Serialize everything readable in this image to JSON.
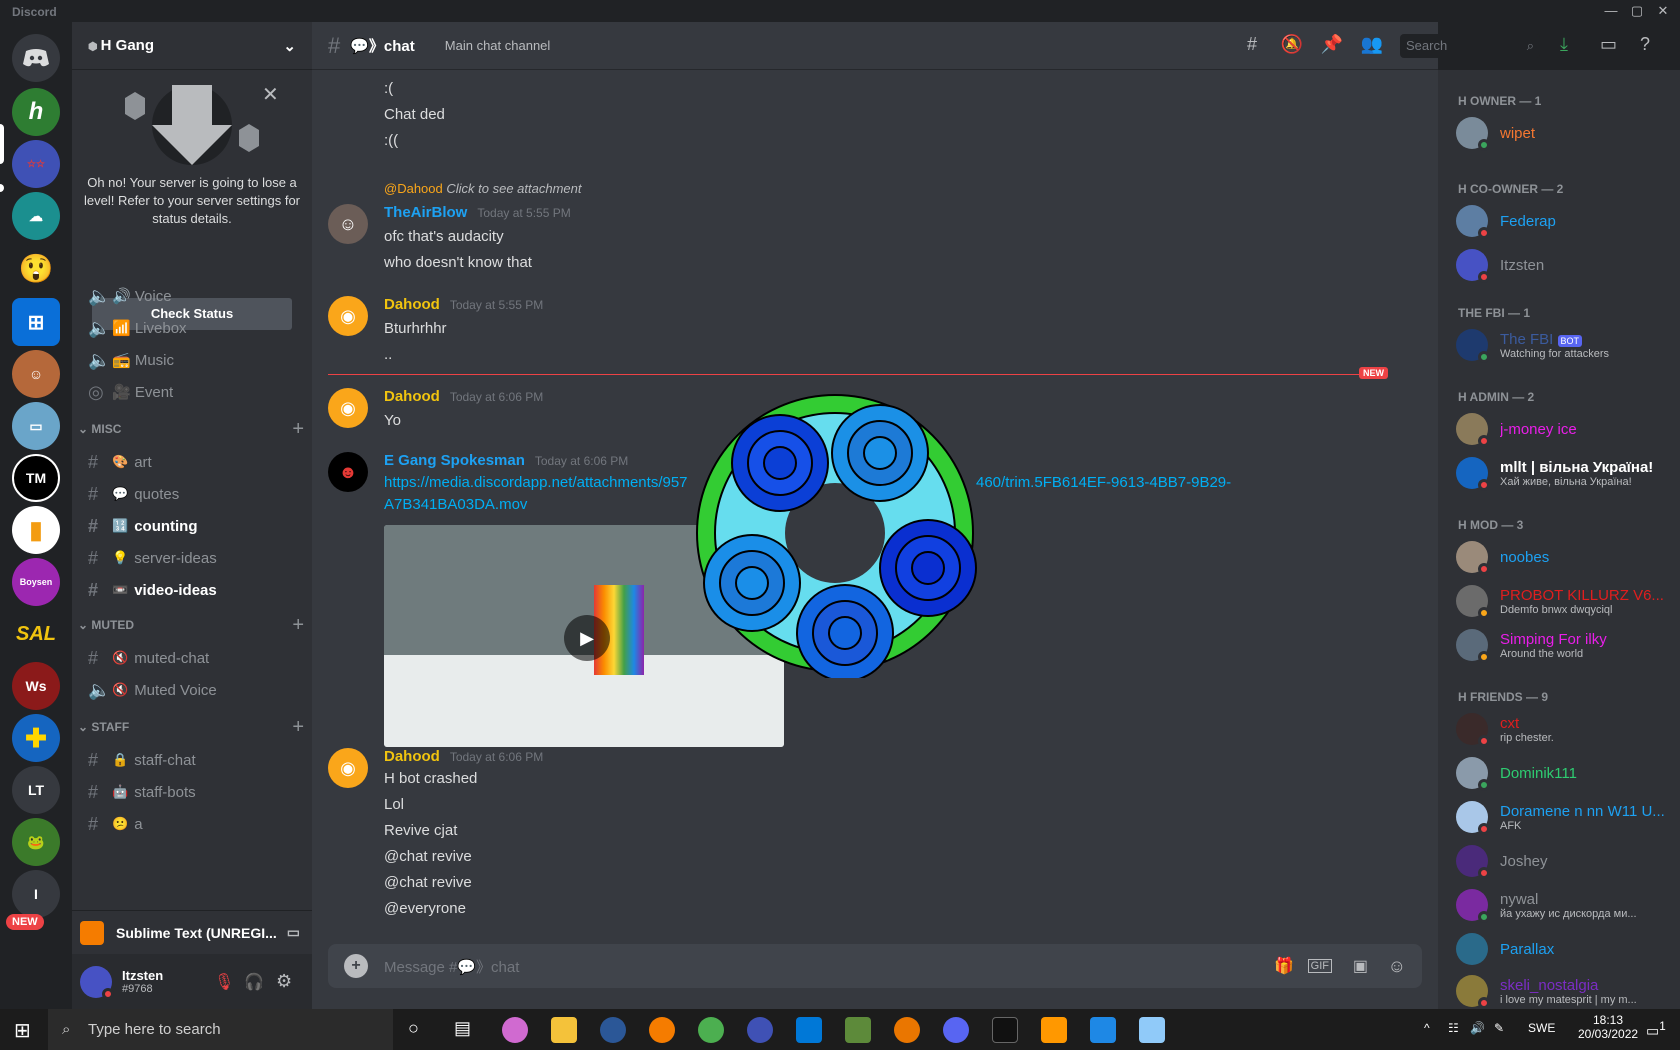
{
  "window": {
    "title": "Discord"
  },
  "server": {
    "name": "H Gang"
  },
  "notice": {
    "text": "Oh no! Your server is going to lose a level! Refer to your server settings for status details.",
    "button": "Check Status"
  },
  "voice_channels": [
    {
      "label": "🔊 Voice"
    },
    {
      "label": "📶 Livebox"
    },
    {
      "label": "📻 Music"
    },
    {
      "label": "🎥 Event"
    }
  ],
  "categories": {
    "misc": "MISC",
    "muted": "MUTED",
    "staff": "STAFF"
  },
  "misc_channels": [
    {
      "emoji": "🎨",
      "label": "art",
      "unread": false
    },
    {
      "emoji": "💬",
      "label": "quotes",
      "unread": false
    },
    {
      "emoji": "🔢",
      "label": "counting",
      "unread": true
    },
    {
      "emoji": "💡",
      "label": "server-ideas",
      "unread": false
    },
    {
      "emoji": "📼",
      "label": "video-ideas",
      "unread": true
    }
  ],
  "muted_channels": [
    {
      "emoji": "🔇",
      "label": "muted-chat"
    },
    {
      "emoji": "🔇",
      "label": "Muted Voice"
    }
  ],
  "staff_channels": [
    {
      "emoji": "🔒",
      "label": "staff-chat"
    },
    {
      "emoji": "🤖",
      "label": "staff-bots"
    },
    {
      "emoji": "😕",
      "label": "a"
    }
  ],
  "activity": {
    "label": "Sublime Text (UNREGI..."
  },
  "user": {
    "name": "Itzsten",
    "tag": "#9768"
  },
  "new_badge": "NEW",
  "channel": {
    "name": "💬》chat",
    "topic": "Main chat channel",
    "search_placeholder": "Search"
  },
  "messages": {
    "early": [
      ":(",
      "Chat ded",
      ":(("
    ],
    "reply_author": "@Dahood",
    "reply_text": "Click to see attachment",
    "m1": {
      "author": "TheAirBlow",
      "time": "Today at 5:55 PM",
      "lines": [
        "ofc that's audacity",
        "who doesn't know that"
      ]
    },
    "m2": {
      "author": "Dahood",
      "time": "Today at 5:55 PM",
      "lines": [
        "Bturhrhhr",
        ".."
      ]
    },
    "m3": {
      "author": "Dahood",
      "time": "Today at 6:06 PM",
      "lines": [
        "Yo"
      ]
    },
    "m4": {
      "author": "E Gang Spokesman",
      "time": "Today at 6:06 PM",
      "link": "https://media.discordapp.net/attachments/957",
      "link2": "460/trim.5FB614EF-9613-4BB7-9B29-",
      "link3": "A7B341BA03DA.mov"
    },
    "m5": {
      "author": "Dahood",
      "time": "Today at 6:06 PM",
      "lines": [
        "H bot crashed",
        "Lol",
        "Revive cjat",
        "@chat revive",
        "@chat revive",
        "@everyrone"
      ]
    }
  },
  "new_label": "NEW",
  "composer": {
    "placeholder": "Message #💬》chat"
  },
  "roles": [
    {
      "label": "H OWNER — 1"
    },
    {
      "label": "H CO-OWNER — 2"
    },
    {
      "label": "THE FBI — 1"
    },
    {
      "label": "H ADMIN — 2"
    },
    {
      "label": "H MOD — 3"
    },
    {
      "label": "H FRIENDS — 9"
    }
  ],
  "members": [
    {
      "name": "wipet",
      "color": "#f57731",
      "status": ""
    },
    {
      "name": "Federap",
      "color": "#1da1f2",
      "status": ""
    },
    {
      "name": "Itzsten",
      "color": "#8e9297",
      "status": ""
    },
    {
      "name": "The FBI",
      "color": "#3b5b9e",
      "status": "Watching for attackers",
      "badge": "BOT"
    },
    {
      "name": "j-money ice",
      "color": "#e91ee9",
      "status": ""
    },
    {
      "name": "mllt | вільна Україна!",
      "color": "#ffffff",
      "status": "Хай живе, вільна Україна!"
    },
    {
      "name": "noobes",
      "color": "#1da1f2",
      "status": ""
    },
    {
      "name": "PROBOT KILLURZ V6...",
      "color": "#e01e1e",
      "status": "Ddemfo bnwx dwqyciql"
    },
    {
      "name": "Simping For ilky",
      "color": "#e91ee9",
      "status": "Around the world"
    },
    {
      "name": "cxt",
      "color": "#e01e1e",
      "status": "rip chester."
    },
    {
      "name": "Dominik111",
      "color": "#2ecc71",
      "status": ""
    },
    {
      "name": "Doramene n nn W11 U...",
      "color": "#1da1f2",
      "status": "AFK"
    },
    {
      "name": "Joshey",
      "color": "#8e9297",
      "status": ""
    },
    {
      "name": "nywal",
      "color": "#8e9297",
      "status": "йа ухажу ис дискорда ми..."
    },
    {
      "name": "Parallax",
      "color": "#1da1f2",
      "status": ""
    },
    {
      "name": "skeli_nostalgia",
      "color": "#7b2dc4",
      "status": "i love my matesprit | my m..."
    }
  ],
  "taskbar": {
    "search_placeholder": "Type here to search",
    "lang": "SWE",
    "time": "18:13",
    "date": "20/03/2022",
    "notif": "1"
  },
  "guild_labels": {
    "tm": "TM",
    "lt": "LT",
    "i": "I",
    "sal": "SAL"
  },
  "colors": {
    "accent": "#5865f2",
    "bg": "#36393f",
    "sidebar": "#2f3136",
    "guilds": "#202225",
    "new": "#ed4245",
    "link": "#00aff4"
  }
}
